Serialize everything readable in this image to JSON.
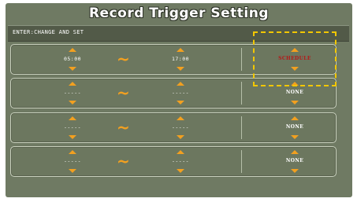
{
  "title": "Record Trigger Setting",
  "instruction": "ENTER:CHANGE AND SET",
  "rows": [
    {
      "start": "05:00",
      "end": "17:00",
      "mode": "SCHEDULE",
      "active": true
    },
    {
      "start": "-----",
      "end": "-----",
      "mode": "NONE",
      "active": false
    },
    {
      "start": "-----",
      "end": "-----",
      "mode": "NONE",
      "active": false
    },
    {
      "start": "-----",
      "end": "-----",
      "mode": "NONE",
      "active": false
    }
  ],
  "range_separator": "~",
  "colors": {
    "panel": "#6f7a63",
    "instruction_bar": "#525a48",
    "arrow": "#f2a020",
    "schedule_text": "#b51818",
    "highlight": "#f2c700"
  },
  "icons": {
    "increment": "triangle-up",
    "decrement": "triangle-down",
    "separator": "tilde"
  }
}
